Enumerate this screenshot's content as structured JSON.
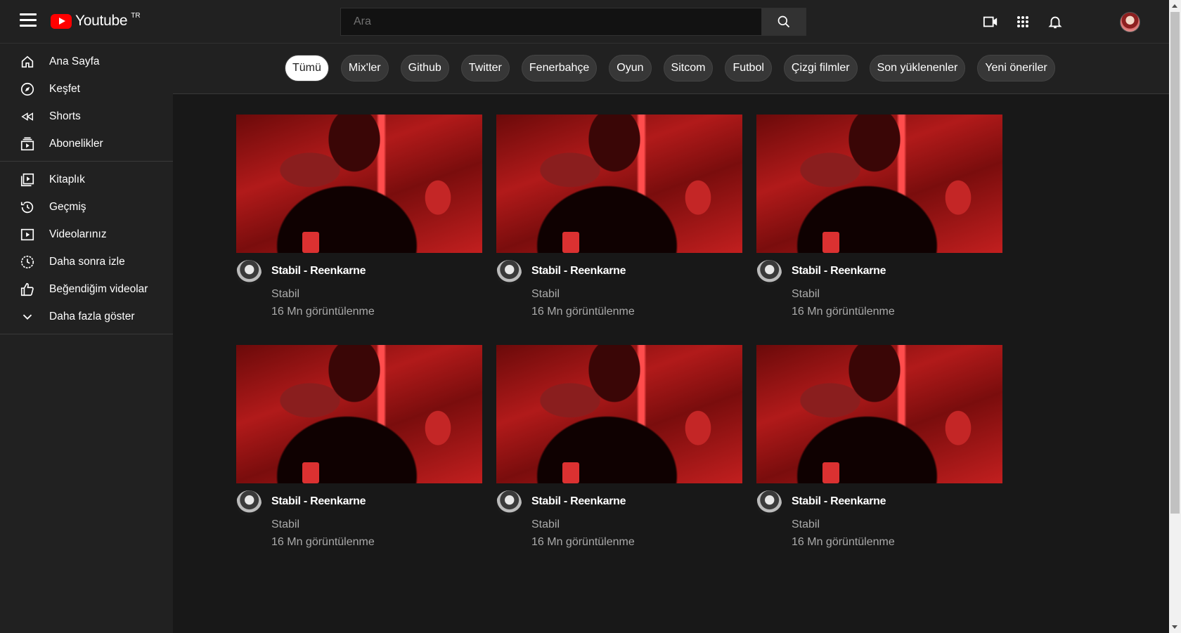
{
  "header": {
    "logo_text": "Youtube",
    "logo_sup": "TR",
    "search_placeholder": "Ara",
    "icons": [
      "menu-icon",
      "search-icon",
      "video-camera-icon",
      "apps-grid-icon",
      "bell-icon",
      "avatar"
    ]
  },
  "sidebar": {
    "primary": [
      {
        "label": "Ana Sayfa",
        "icon": "home-icon"
      },
      {
        "label": "Keşfet",
        "icon": "compass-icon"
      },
      {
        "label": "Shorts",
        "icon": "shorts-icon"
      },
      {
        "label": "Abonelikler",
        "icon": "subscriptions-icon"
      }
    ],
    "secondary": [
      {
        "label": "Kitaplık",
        "icon": "library-icon"
      },
      {
        "label": "Geçmiş",
        "icon": "history-icon"
      },
      {
        "label": "Videolarınız",
        "icon": "your-videos-icon"
      },
      {
        "label": "Daha sonra izle",
        "icon": "watch-later-icon"
      },
      {
        "label": "Beğendiğim videolar",
        "icon": "thumbs-up-icon"
      },
      {
        "label": "Daha fazla göster",
        "icon": "chevron-down-icon"
      }
    ]
  },
  "chips": [
    "Tümü",
    "Mix'ler",
    "Github",
    "Twitter",
    "Fenerbahçe",
    "Oyun",
    "Sitcom",
    "Futbol",
    "Çizgi filmler",
    "Son yüklenenler",
    "Yeni öneriler"
  ],
  "videos": [
    {
      "title": "Stabil - Reenkarne",
      "channel": "Stabil",
      "views": "16 Mn görüntülenme"
    },
    {
      "title": "Stabil - Reenkarne",
      "channel": "Stabil",
      "views": "16 Mn görüntülenme"
    },
    {
      "title": "Stabil - Reenkarne",
      "channel": "Stabil",
      "views": "16 Mn görüntülenme"
    },
    {
      "title": "Stabil - Reenkarne",
      "channel": "Stabil",
      "views": "16 Mn görüntülenme"
    },
    {
      "title": "Stabil - Reenkarne",
      "channel": "Stabil",
      "views": "16 Mn görüntülenme"
    },
    {
      "title": "Stabil - Reenkarne",
      "channel": "Stabil",
      "views": "16 Mn görüntülenme"
    }
  ],
  "colors": {
    "background": "#181818",
    "panel": "#212121",
    "accent": "#ff0000",
    "chip": "#373737",
    "muted_text": "#aaaaaa"
  }
}
